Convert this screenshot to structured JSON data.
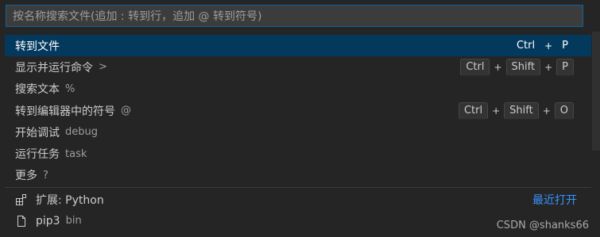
{
  "search": {
    "placeholder": "按名称搜索文件(追加 : 转到行，追加 @ 转到符号)"
  },
  "commands": [
    {
      "label": "转到文件",
      "desc": "",
      "keys": [
        "Ctrl",
        "P"
      ]
    },
    {
      "label": "显示并运行命令",
      "desc": ">",
      "keys": [
        "Ctrl",
        "Shift",
        "P"
      ]
    },
    {
      "label": "搜索文本",
      "desc": "%",
      "keys": []
    },
    {
      "label": "转到编辑器中的符号",
      "desc": "@",
      "keys": [
        "Ctrl",
        "Shift",
        "O"
      ]
    },
    {
      "label": "开始调试",
      "desc": "debug",
      "keys": []
    },
    {
      "label": "运行任务",
      "desc": "task",
      "keys": []
    },
    {
      "label": "更多",
      "desc": "?",
      "keys": []
    }
  ],
  "recent": {
    "heading": "最近打开",
    "items": [
      {
        "label": "扩展: Python",
        "desc": "",
        "icon": "extensions-icon"
      },
      {
        "label": "pip3",
        "desc": "bin",
        "icon": "file-icon"
      }
    ]
  },
  "watermark": "CSDN @shanks66",
  "colors": {
    "accent": "#0e639c",
    "selection": "#04395e",
    "link": "#3794ff",
    "background": "#252526"
  }
}
